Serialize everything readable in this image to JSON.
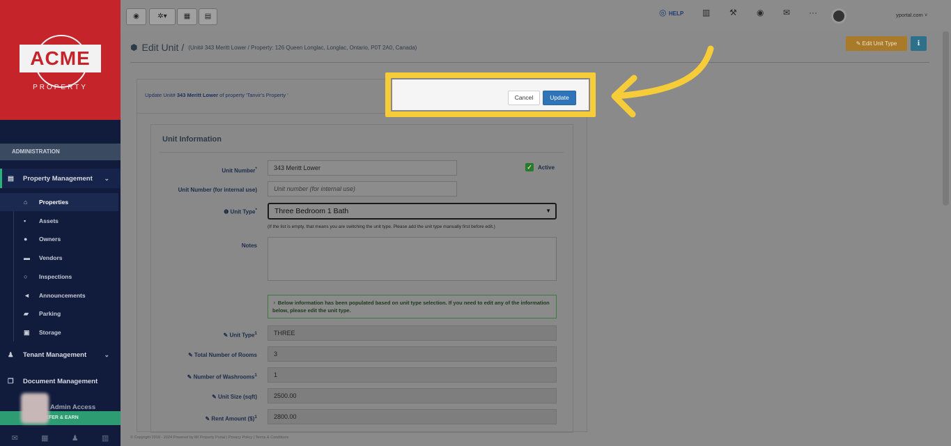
{
  "sidebar": {
    "logo_main": "ACME",
    "logo_sub": "PROPERTY",
    "section_label": "ADMINISTRATION",
    "property_management": "Property Management",
    "items": [
      {
        "label": "Properties",
        "icon": "home-icon"
      },
      {
        "label": "Assets",
        "icon": "assets-icon"
      },
      {
        "label": "Owners",
        "icon": "owner-icon"
      },
      {
        "label": "Vendors",
        "icon": "vendor-icon"
      },
      {
        "label": "Inspections",
        "icon": "search-icon"
      },
      {
        "label": "Announcements",
        "icon": "megaphone-icon"
      },
      {
        "label": "Parking",
        "icon": "car-icon"
      },
      {
        "label": "Storage",
        "icon": "storage-icon"
      }
    ],
    "tenant_management": "Tenant Management",
    "document_management": "Document Management",
    "admin_access": "Admin Access",
    "refer_earn": "REFER & EARN"
  },
  "topbar": {
    "help": "HELP",
    "user_email_suffix": "yportal.com"
  },
  "page": {
    "title": "Edit Unit",
    "separator": "/",
    "subtitle": "(Unit# 343 Meritt Lower / Property: 126 Queen Longlac, Longlac, Ontario, P0T 2A0, Canada)",
    "edit_unit_type_btn": "Edit Unit Type"
  },
  "card": {
    "update_note_prefix": "Update Unit# ",
    "update_note_unit": "343 Meritt Lower",
    "update_note_suffix": " of property 'Tanvir's Property '",
    "section_title": "Unit Information",
    "cancel": "Cancel",
    "update": "Update"
  },
  "form": {
    "unit_number_label": "Unit Number",
    "unit_number_value": "343 Meritt Lower",
    "active_label": "Active",
    "internal_label": "Unit Number (for internal use)",
    "internal_placeholder": "Unit number (for internal use)",
    "unit_type_label": "Unit Type",
    "unit_type_value": "Three Bedroom 1 Bath",
    "unit_type_hint": "(If the list is empty, that means you are switching the unit type. Please add the unit type manually first before edit.)",
    "notes_label": "Notes",
    "notice": "Below information has been populated based on unit type selection. If you need to edit any of the information below, please edit the unit type.",
    "fields": [
      {
        "label": "Unit Type",
        "value": "THREE"
      },
      {
        "label": "Total Number of Rooms",
        "value": "3"
      },
      {
        "label": "Number of Washrooms",
        "value": "1"
      },
      {
        "label": "Unit Size (sqft)",
        "value": "2500.00"
      },
      {
        "label": "Rent Amount ($)",
        "value": "2800.00"
      }
    ]
  },
  "footer": "© Copyright 2018 - 2024 Powered by MI Property Portal | Privacy Policy | Terms & Conditions"
}
